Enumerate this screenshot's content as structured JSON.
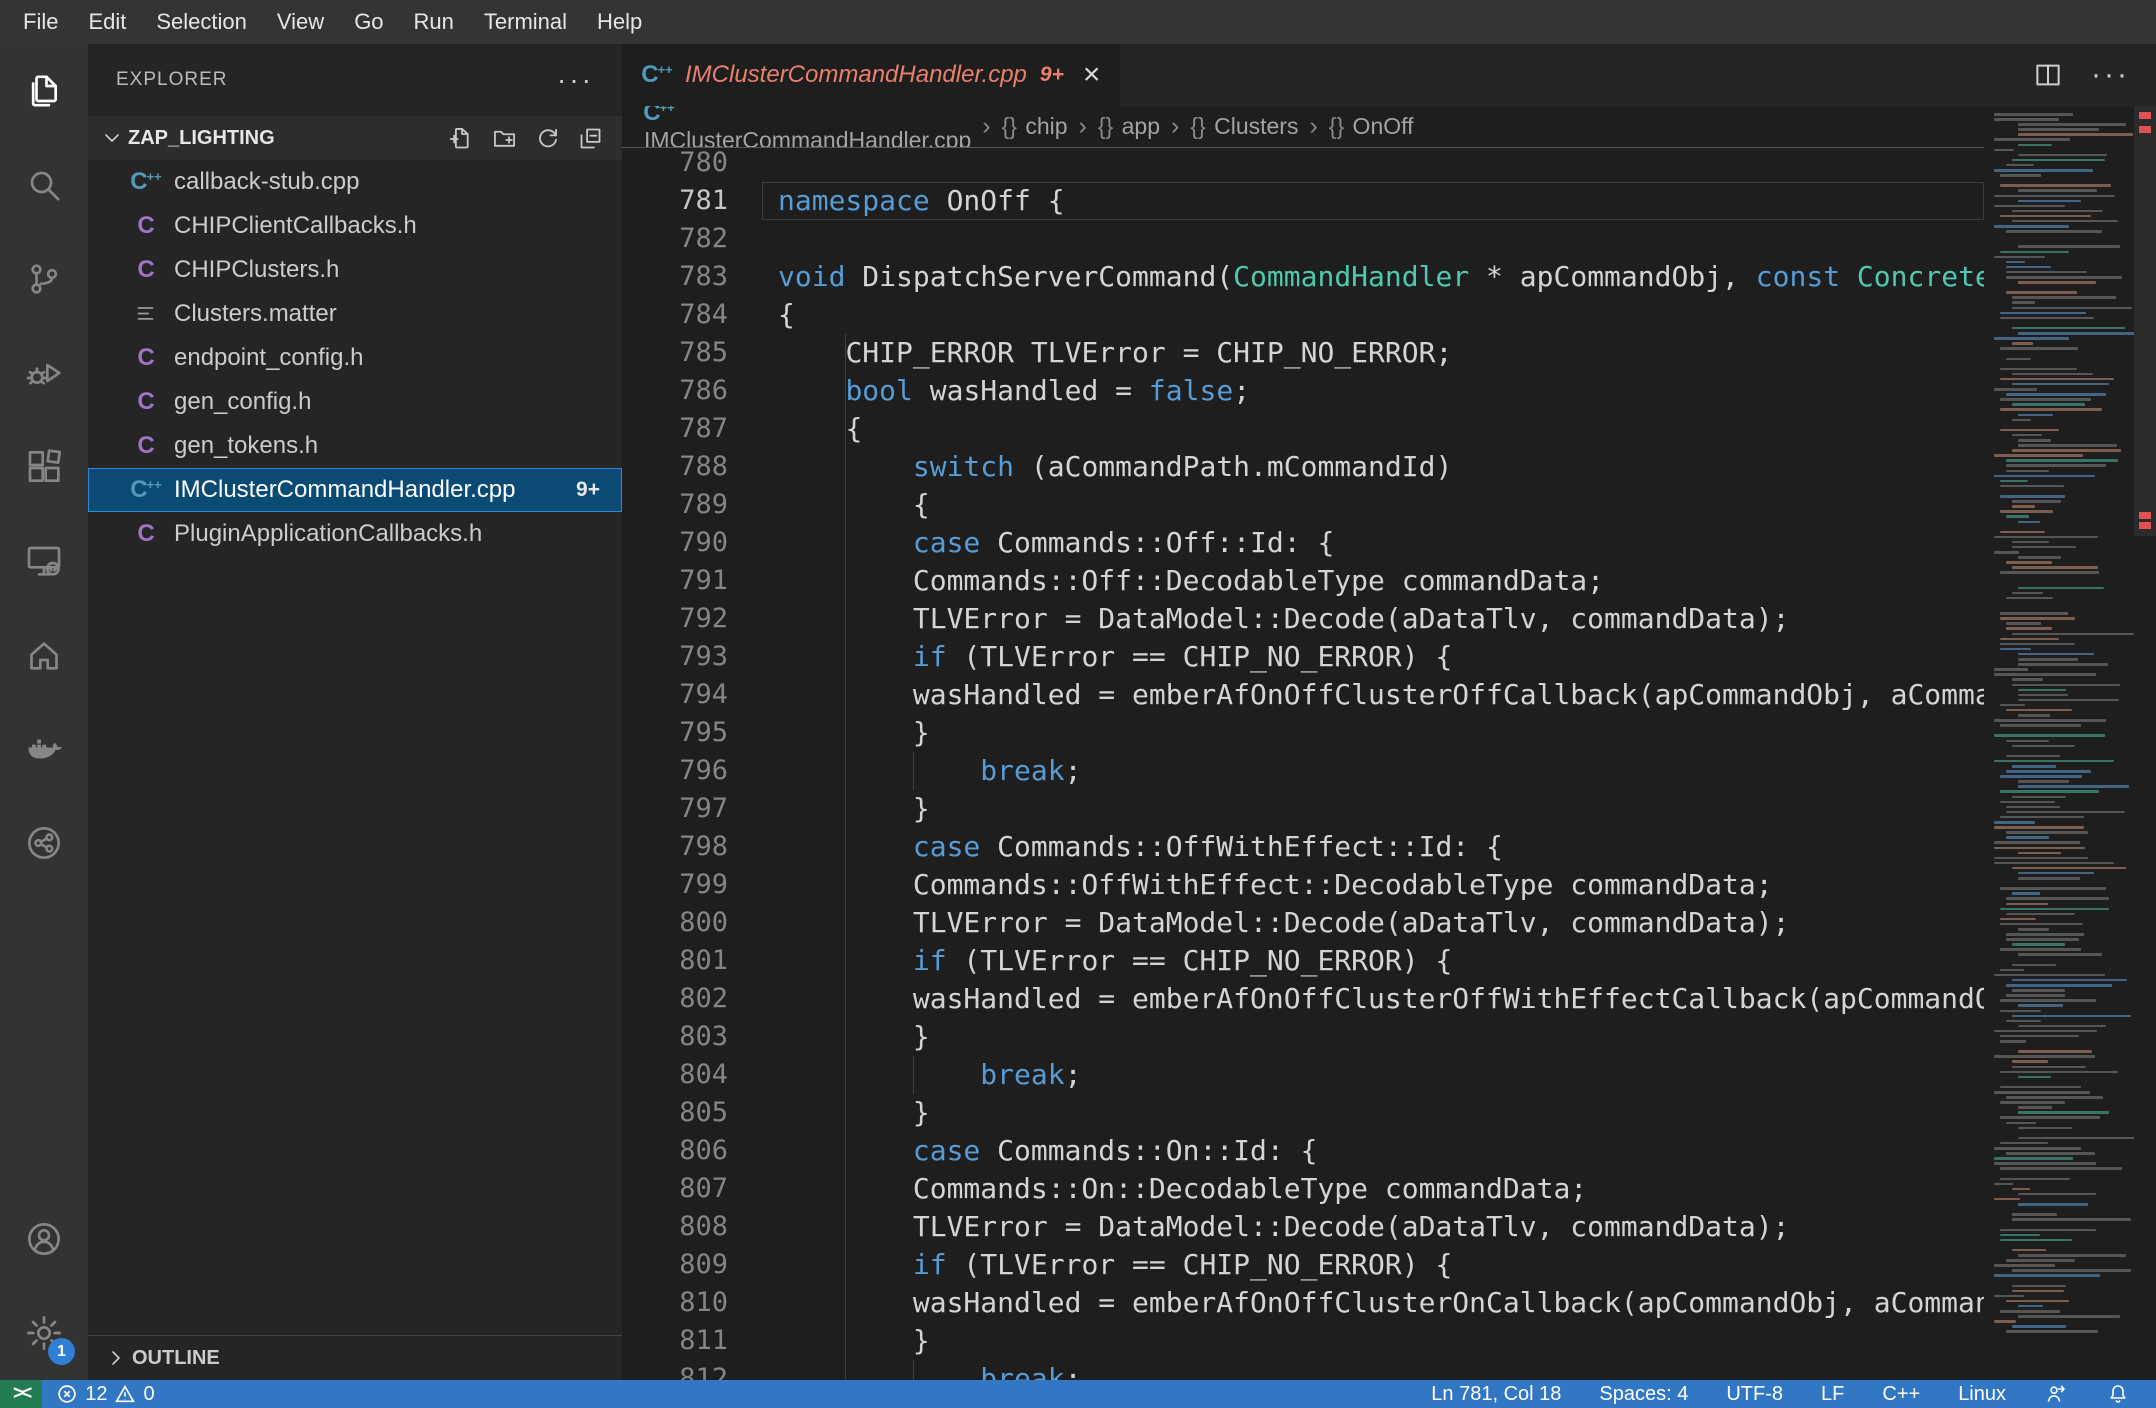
{
  "menu_bar": {
    "items": [
      "File",
      "Edit",
      "Selection",
      "View",
      "Go",
      "Run",
      "Terminal",
      "Help"
    ]
  },
  "activity_bar": {
    "top": [
      {
        "name": "explorer",
        "label": "Explorer",
        "active": true
      },
      {
        "name": "search",
        "label": "Search"
      },
      {
        "name": "source-control",
        "label": "Source Control"
      },
      {
        "name": "run-debug",
        "label": "Run and Debug"
      },
      {
        "name": "extensions",
        "label": "Extensions"
      },
      {
        "name": "remote-explorer",
        "label": "Remote Explorer"
      },
      {
        "name": "home",
        "label": "Home"
      },
      {
        "name": "docker",
        "label": "Docker"
      },
      {
        "name": "git-circle",
        "label": "Git Graph"
      }
    ],
    "bottom": [
      {
        "name": "account",
        "label": "Accounts"
      },
      {
        "name": "settings",
        "label": "Manage",
        "badge": "1"
      }
    ]
  },
  "sidebar": {
    "title": "EXPLORER",
    "section_label": "ZAP_LIGHTING",
    "outline_label": "OUTLINE",
    "files": [
      {
        "name": "callback-stub.cpp",
        "icon": "cpp"
      },
      {
        "name": "CHIPClientCallbacks.h",
        "icon": "header"
      },
      {
        "name": "CHIPClusters.h",
        "icon": "header"
      },
      {
        "name": "Clusters.matter",
        "icon": "matter"
      },
      {
        "name": "endpoint_config.h",
        "icon": "header"
      },
      {
        "name": "gen_config.h",
        "icon": "header"
      },
      {
        "name": "gen_tokens.h",
        "icon": "header"
      },
      {
        "name": "IMClusterCommandHandler.cpp",
        "icon": "cpp",
        "selected": true,
        "badge": "9+"
      },
      {
        "name": "PluginApplicationCallbacks.h",
        "icon": "header"
      }
    ]
  },
  "editor": {
    "tab": {
      "label": "IMClusterCommandHandler.cpp",
      "badge": "9+"
    },
    "breadcrumbs": [
      "IMClusterCommandHandler.cpp",
      "chip",
      "app",
      "Clusters",
      "OnOff"
    ],
    "code": {
      "lines": [
        {
          "n": "780",
          "i": 0,
          "t": []
        },
        {
          "n": "781",
          "i": 0,
          "cur": true,
          "t": [
            [
              "k",
              "namespace"
            ],
            [
              "p",
              " OnOff {"
            ]
          ]
        },
        {
          "n": "782",
          "i": 0,
          "t": []
        },
        {
          "n": "783",
          "i": 0,
          "t": [
            [
              "k",
              "void"
            ],
            [
              "p",
              " DispatchServerCommand("
            ],
            [
              "y",
              "CommandHandler"
            ],
            [
              "p",
              " * apCommandObj, "
            ],
            [
              "k",
              "const"
            ],
            [
              "p",
              " "
            ],
            [
              "y",
              "ConcreteCommandPath"
            ]
          ]
        },
        {
          "n": "784",
          "i": 0,
          "t": [
            [
              "p",
              "{"
            ]
          ]
        },
        {
          "n": "785",
          "i": 4,
          "t": [
            [
              "p",
              "CHIP_ERROR TLVError = CHIP_NO_ERROR;"
            ]
          ]
        },
        {
          "n": "786",
          "i": 4,
          "t": [
            [
              "k",
              "bool"
            ],
            [
              "p",
              " wasHandled = "
            ],
            [
              "k",
              "false"
            ],
            [
              "p",
              ";"
            ]
          ]
        },
        {
          "n": "787",
          "i": 4,
          "t": [
            [
              "p",
              "{"
            ]
          ]
        },
        {
          "n": "788",
          "i": 8,
          "t": [
            [
              "k",
              "switch"
            ],
            [
              "p",
              " (aCommandPath.mCommandId)"
            ]
          ]
        },
        {
          "n": "789",
          "i": 8,
          "t": [
            [
              "p",
              "{"
            ]
          ]
        },
        {
          "n": "790",
          "i": 8,
          "t": [
            [
              "k",
              "case"
            ],
            [
              "p",
              " Commands::Off::Id: {"
            ]
          ]
        },
        {
          "n": "791",
          "i": 8,
          "t": [
            [
              "p",
              "Commands::Off::DecodableType commandData;"
            ]
          ]
        },
        {
          "n": "792",
          "i": 8,
          "t": [
            [
              "p",
              "TLVError = DataModel::Decode(aDataTlv, commandData);"
            ]
          ]
        },
        {
          "n": "793",
          "i": 8,
          "t": [
            [
              "k",
              "if"
            ],
            [
              "p",
              " (TLVError == CHIP_NO_ERROR) {"
            ]
          ]
        },
        {
          "n": "794",
          "i": 8,
          "t": [
            [
              "p",
              "wasHandled = emberAfOnOffClusterOffCallback(apCommandObj, aCommandPath, commandData);"
            ]
          ]
        },
        {
          "n": "795",
          "i": 8,
          "t": [
            [
              "p",
              "}"
            ]
          ]
        },
        {
          "n": "796",
          "i": 12,
          "t": [
            [
              "k",
              "break"
            ],
            [
              "p",
              ";"
            ]
          ]
        },
        {
          "n": "797",
          "i": 8,
          "t": [
            [
              "p",
              "}"
            ]
          ]
        },
        {
          "n": "798",
          "i": 8,
          "t": [
            [
              "k",
              "case"
            ],
            [
              "p",
              " Commands::OffWithEffect::Id: {"
            ]
          ]
        },
        {
          "n": "799",
          "i": 8,
          "t": [
            [
              "p",
              "Commands::OffWithEffect::DecodableType commandData;"
            ]
          ]
        },
        {
          "n": "800",
          "i": 8,
          "t": [
            [
              "p",
              "TLVError = DataModel::Decode(aDataTlv, commandData);"
            ]
          ]
        },
        {
          "n": "801",
          "i": 8,
          "t": [
            [
              "k",
              "if"
            ],
            [
              "p",
              " (TLVError == CHIP_NO_ERROR) {"
            ]
          ]
        },
        {
          "n": "802",
          "i": 8,
          "t": [
            [
              "p",
              "wasHandled = emberAfOnOffClusterOffWithEffectCallback(apCommandObj, aCommandPath, commandData);"
            ]
          ]
        },
        {
          "n": "803",
          "i": 8,
          "t": [
            [
              "p",
              "}"
            ]
          ]
        },
        {
          "n": "804",
          "i": 12,
          "t": [
            [
              "k",
              "break"
            ],
            [
              "p",
              ";"
            ]
          ]
        },
        {
          "n": "805",
          "i": 8,
          "t": [
            [
              "p",
              "}"
            ]
          ]
        },
        {
          "n": "806",
          "i": 8,
          "t": [
            [
              "k",
              "case"
            ],
            [
              "p",
              " Commands::On::Id: {"
            ]
          ]
        },
        {
          "n": "807",
          "i": 8,
          "t": [
            [
              "p",
              "Commands::On::DecodableType commandData;"
            ]
          ]
        },
        {
          "n": "808",
          "i": 8,
          "t": [
            [
              "p",
              "TLVError = DataModel::Decode(aDataTlv, commandData);"
            ]
          ]
        },
        {
          "n": "809",
          "i": 8,
          "t": [
            [
              "k",
              "if"
            ],
            [
              "p",
              " (TLVError == CHIP_NO_ERROR) {"
            ]
          ]
        },
        {
          "n": "810",
          "i": 8,
          "t": [
            [
              "p",
              "wasHandled = emberAfOnOffClusterOnCallback(apCommandObj, aCommandPath, commandData);"
            ]
          ]
        },
        {
          "n": "811",
          "i": 8,
          "t": [
            [
              "p",
              "}"
            ]
          ]
        },
        {
          "n": "812",
          "i": 12,
          "t": [
            [
              "k",
              "break"
            ],
            [
              "p",
              ";"
            ]
          ]
        }
      ]
    }
  },
  "status_bar": {
    "remote_label": "><",
    "errors": "12",
    "warnings": "0",
    "right_items": [
      {
        "name": "cursor-position",
        "label": "Ln 781, Col 18"
      },
      {
        "name": "indentation",
        "label": "Spaces: 4"
      },
      {
        "name": "encoding",
        "label": "UTF-8"
      },
      {
        "name": "eol",
        "label": "LF"
      },
      {
        "name": "language-mode",
        "label": "C++"
      },
      {
        "name": "remote-os",
        "label": "Linux"
      }
    ]
  },
  "colors": {
    "status_bar_bg": "#3277c4",
    "remote_bg": "#217c52",
    "selection_bg": "#0a4a74",
    "selection_border": "#2b88d8",
    "tab_modified_fg": "#e8806b",
    "keyword": "#569cd6",
    "type": "#4ec9b0",
    "plain": "#d4d4d4",
    "cpp_icon": "#519aba",
    "header_icon": "#a074c4",
    "badge_bg": "#2f7fd6"
  }
}
